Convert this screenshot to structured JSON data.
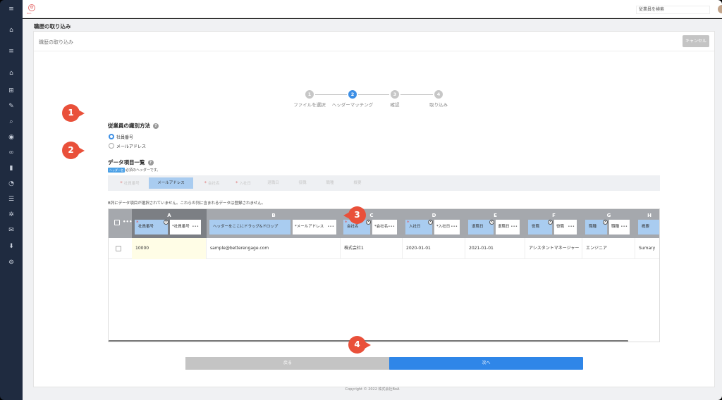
{
  "app": {
    "logo_text": "BOA",
    "search_placeholder": "従業員を検索"
  },
  "page_title": "職歴の取り込み",
  "card": {
    "title": "職歴の取り込み",
    "cancel_label": "キャンセル"
  },
  "steps": [
    {
      "num": "1",
      "label": "ファイルを選択",
      "active": false
    },
    {
      "num": "2",
      "label": "ヘッダーマッチング",
      "active": true
    },
    {
      "num": "3",
      "label": "確認",
      "active": false
    },
    {
      "num": "4",
      "label": "取り込み",
      "active": false
    }
  ],
  "identify": {
    "title": "従業員の識別方法",
    "options": [
      {
        "label": "社員番号",
        "selected": true
      },
      {
        "label": "メールアドレス",
        "selected": false
      }
    ]
  },
  "data_items": {
    "title": "データ項目一覧",
    "badge": "ヘッダー名",
    "badge_note": "必須のヘッダーです。",
    "chips": [
      {
        "label": "社員番号",
        "required": true,
        "selected": false
      },
      {
        "label": "メールアドレス",
        "required": false,
        "selected": true
      },
      {
        "label": "会社名",
        "required": true,
        "selected": false
      },
      {
        "label": "入社日",
        "required": true,
        "selected": false
      },
      {
        "label": "退職日",
        "required": false,
        "selected": false
      },
      {
        "label": "役職",
        "required": false,
        "selected": false
      },
      {
        "label": "職種",
        "required": false,
        "selected": false
      },
      {
        "label": "概要",
        "required": false,
        "selected": false
      }
    ]
  },
  "notice": "B列にデータ項目が選択されていません。これらの列に含まれるデータは登録されません。",
  "table": {
    "columns": [
      {
        "letter": "A",
        "mapped": "社員番号",
        "file_header": "*社員番号",
        "required": true,
        "selected": true
      },
      {
        "letter": "B",
        "mapped": "ヘッダーをここにドラッグ&ドロップ",
        "file_header": "*メールアドレス",
        "required": false,
        "selected": false
      },
      {
        "letter": "C",
        "mapped": "会社名",
        "file_header": "*会社名",
        "required": true,
        "selected": false
      },
      {
        "letter": "D",
        "mapped": "入社日",
        "file_header": "*入社日",
        "required": true,
        "selected": false
      },
      {
        "letter": "E",
        "mapped": "退職日",
        "file_header": "退職日",
        "required": false,
        "selected": false
      },
      {
        "letter": "F",
        "mapped": "役職",
        "file_header": "役職",
        "required": false,
        "selected": false
      },
      {
        "letter": "G",
        "mapped": "職種",
        "file_header": "職種",
        "required": false,
        "selected": false
      },
      {
        "letter": "H",
        "mapped": "概要",
        "file_header": "",
        "required": false,
        "selected": false
      }
    ],
    "rows": [
      [
        "10000",
        "sample@betterengage.com",
        "株式会社1",
        "2020-01-01",
        "2021-01-01",
        "アシスタントマネージャー",
        "エンジニア",
        "Sumary"
      ]
    ]
  },
  "buttons": {
    "back": "戻る",
    "next": "次へ"
  },
  "footer": "Copyright © 2022 株式会社BoA",
  "callouts": [
    "1",
    "2",
    "3",
    "4"
  ],
  "sidebar_icons": [
    "menu-icon",
    "home-icon",
    "menu-icon",
    "home-icon",
    "org-icon",
    "user-edit-icon",
    "search-icon",
    "chat-icon",
    "link-icon",
    "chart-icon",
    "gauge-icon",
    "list-icon",
    "gear-badge-icon",
    "mail-icon",
    "download-icon",
    "settings-icon"
  ],
  "colors": {
    "sidebar": "#1f2b40",
    "accent": "#2f86e8",
    "callout": "#e9503a",
    "mapped_header": "#a9ccf0"
  }
}
